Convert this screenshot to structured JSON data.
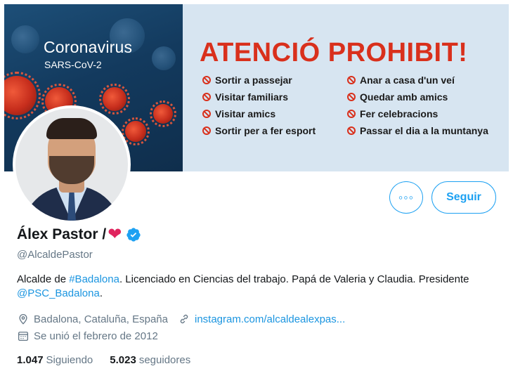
{
  "banner": {
    "corona_title": "Coronavirus",
    "corona_sub": "SARS-CoV-2",
    "prohibit_title": "ATENCIÓ PROHIBIT!",
    "rules_left": [
      "Sortir a passejar",
      "Visitar familiars",
      "Visitar amics",
      "Sortir per a fer esport"
    ],
    "rules_right": [
      "Anar a casa d'un veí",
      "Quedar amb amics",
      "Fer celebracions",
      "Passar el dia a la muntanya"
    ]
  },
  "actions": {
    "more_label": "◦◦◦",
    "follow_label": "Seguir"
  },
  "profile": {
    "name": "Álex Pastor /",
    "heart": "❤",
    "handle": "@AlcaldePastor",
    "bio_pre": "Alcalde de ",
    "bio_hashtag": "#Badalona",
    "bio_mid": ". Licenciado en Ciencias del trabajo. Papá de Valeria y Claudia. Presidente ",
    "bio_mention": "@PSC_Badalona",
    "bio_end": ".",
    "location": "Badalona, Cataluña, España",
    "website": "instagram.com/alcaldealexpas...",
    "joined": "Se unió el febrero de 2012"
  },
  "stats": {
    "following_count": "1.047",
    "following_label": "Siguiendo",
    "followers_count": "5.023",
    "followers_label": "seguidores"
  },
  "colors": {
    "accent": "#1da1f2",
    "link": "#1b95e0",
    "prohibit_red": "#d9301c",
    "heart": "#e0245e"
  },
  "icons": [
    "location-pin-icon",
    "link-icon",
    "calendar-icon",
    "verified-badge-icon",
    "ban-icon"
  ]
}
